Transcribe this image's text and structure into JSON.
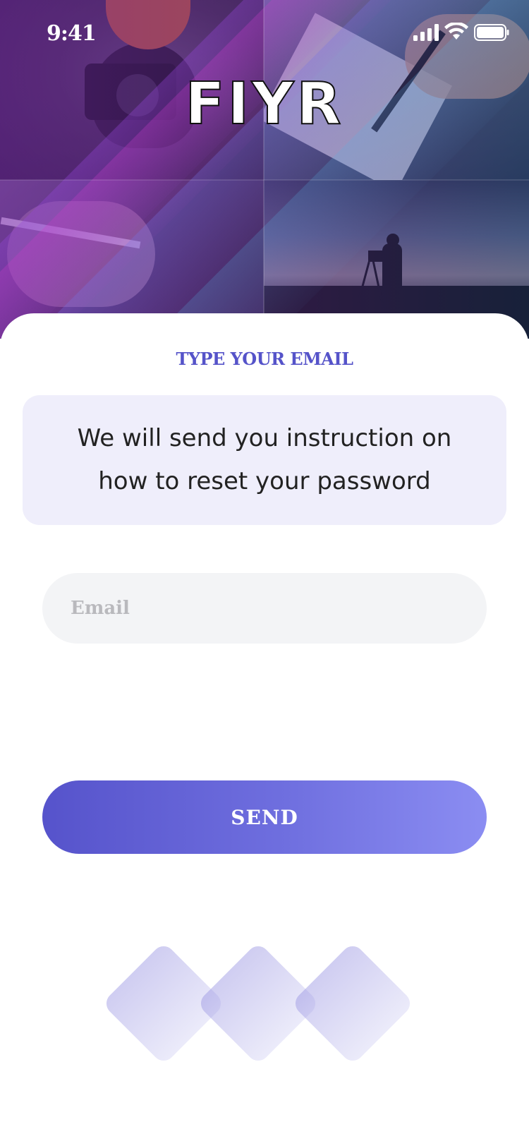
{
  "status_bar": {
    "time": "9:41"
  },
  "hero": {
    "brand": "FIYR"
  },
  "form": {
    "title": "TYPE YOUR EMAIL",
    "info": "We will send you instruction on how to reset your password",
    "email_placeholder": "Email",
    "email_value": "",
    "send_label": "SEND"
  },
  "icons": [
    "signal-icon",
    "wifi-icon",
    "battery-icon",
    "decorative-diamond-icon"
  ],
  "colors": {
    "accent": "#5553c9",
    "button_start": "#5653cb",
    "button_end": "#8b8df2",
    "info_bg": "#efeefb",
    "input_bg": "#f3f4f6"
  }
}
